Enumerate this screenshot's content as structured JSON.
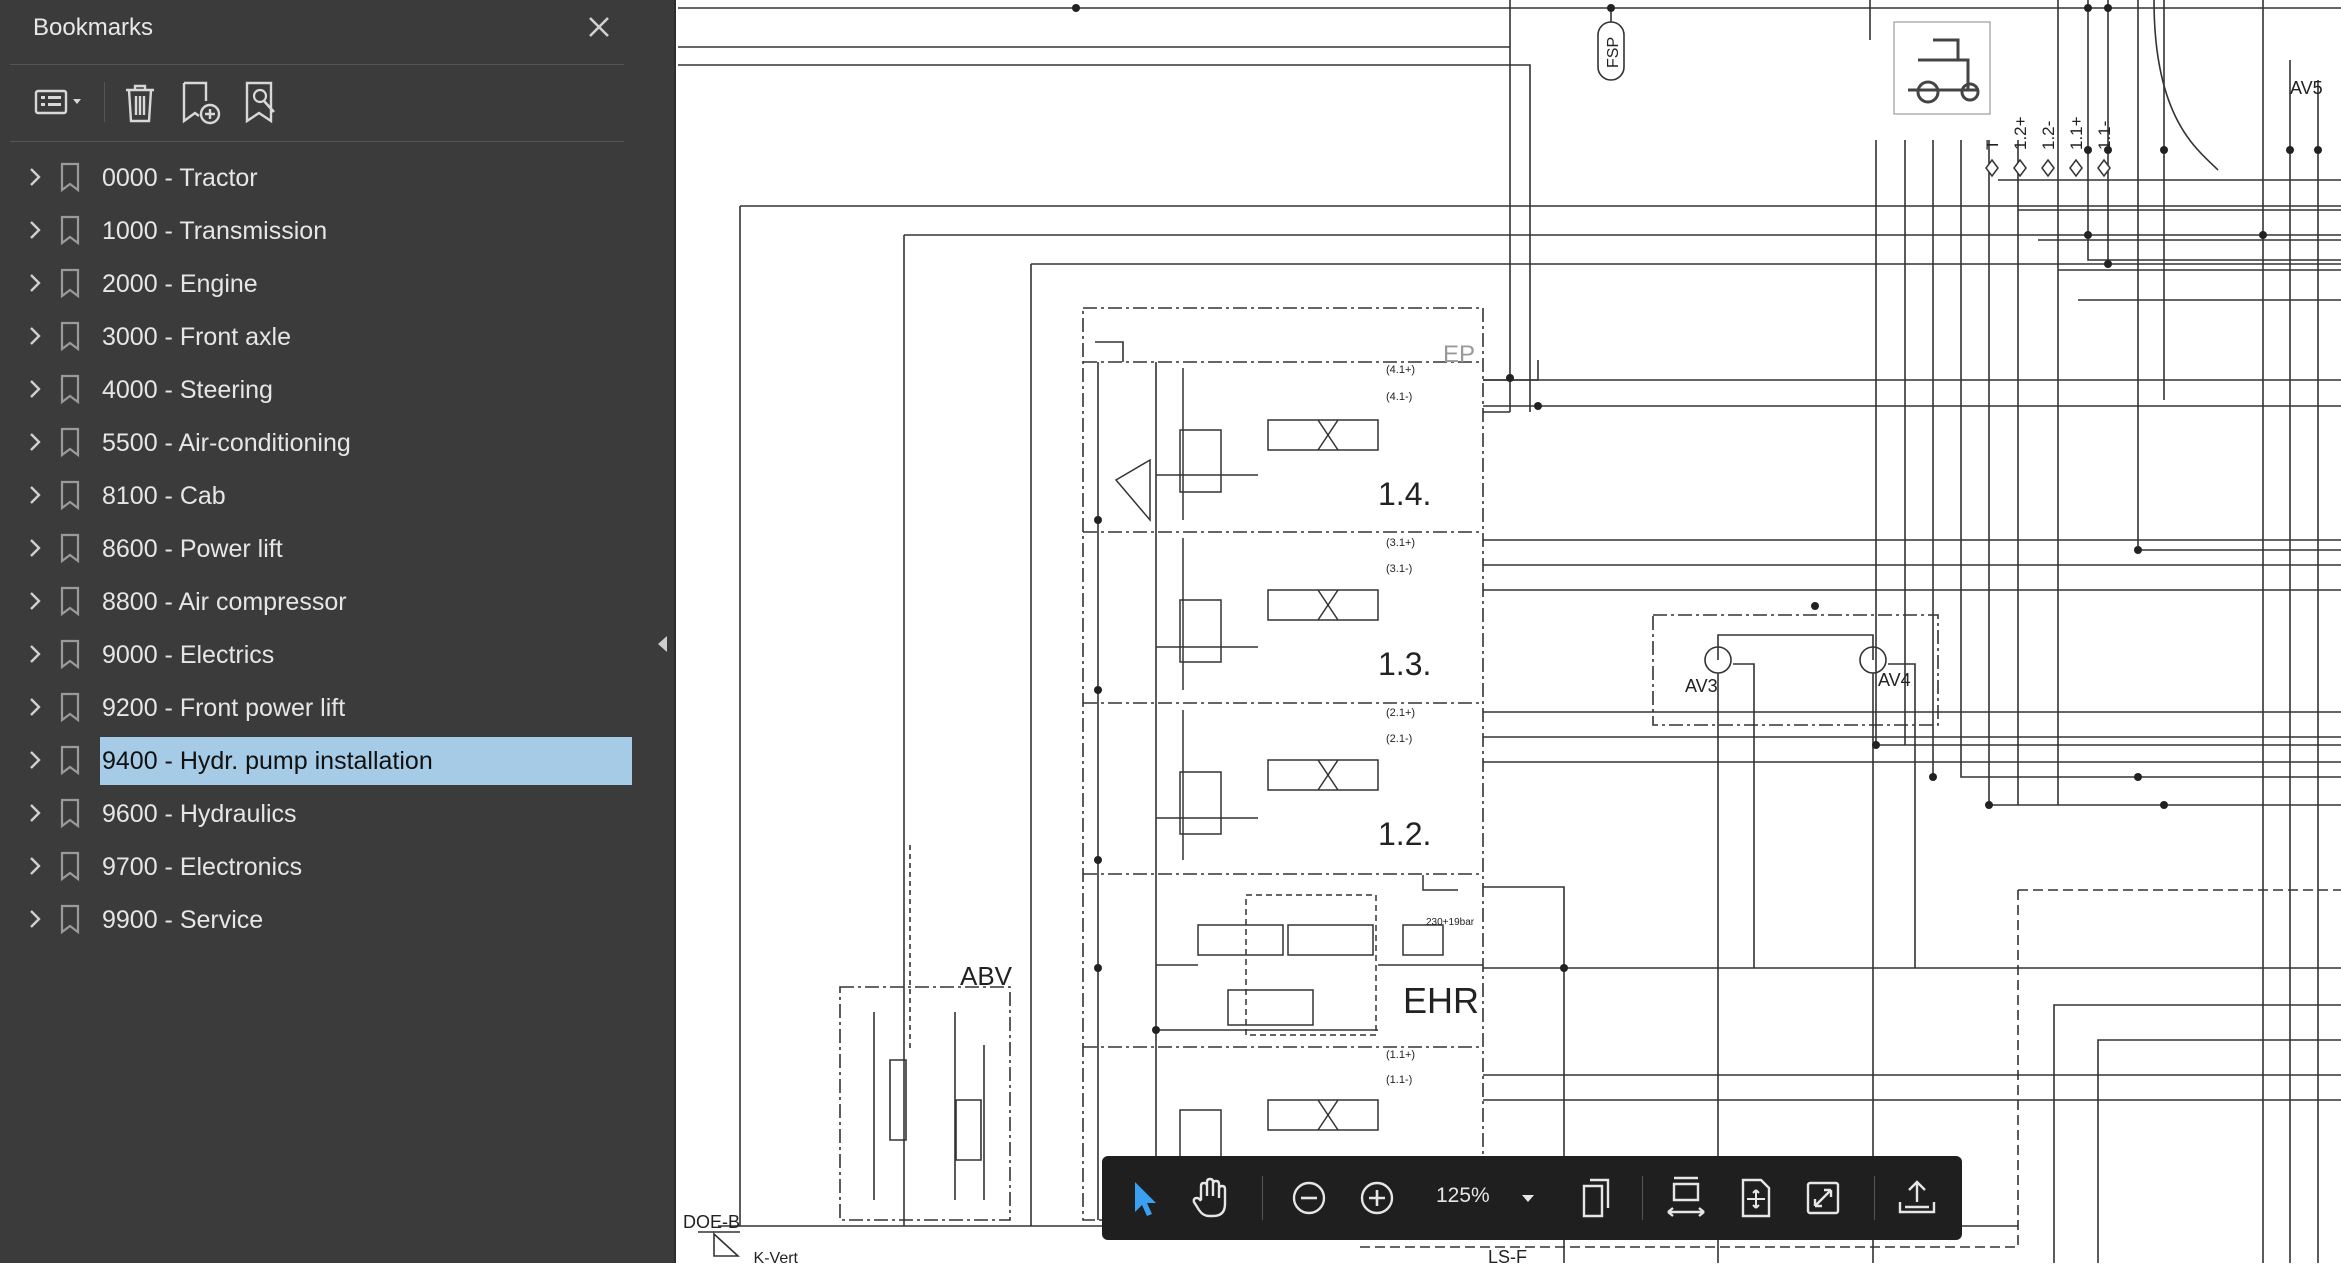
{
  "sidebar": {
    "title": "Bookmarks",
    "toolbar": {
      "options_icon": "list-options-icon",
      "delete_icon": "trash-icon",
      "add_icon": "add-bookmark-icon",
      "find_icon": "bookmark-search-icon"
    },
    "items": [
      {
        "label": "0000 - Tractor"
      },
      {
        "label": "1000 - Transmission"
      },
      {
        "label": "2000 - Engine"
      },
      {
        "label": "3000 - Front axle"
      },
      {
        "label": "4000 - Steering"
      },
      {
        "label": "5500 - Air-conditioning"
      },
      {
        "label": "8100 - Cab"
      },
      {
        "label": "8600 - Power lift"
      },
      {
        "label": "8800 - Air compressor"
      },
      {
        "label": "9000 - Electrics"
      },
      {
        "label": "9200 - Front power lift"
      },
      {
        "label": "9400 - Hydr. pump installation"
      },
      {
        "label": "9600 - Hydraulics"
      },
      {
        "label": "9700 - Electronics"
      },
      {
        "label": "9900 - Service"
      }
    ],
    "selected_index": 11
  },
  "drawing": {
    "labels": {
      "fsp": "FSP",
      "ep": "EP",
      "v14": "1.4.",
      "v13": "1.3.",
      "v12": "1.2.",
      "ehr": "EHR",
      "abv": "ABV",
      "av3": "AV3",
      "av4": "AV4",
      "av5": "AV5",
      "doe": "DOE-B",
      "kvert": "K-Vert",
      "lsf": "LS-F",
      "ports": [
        "T",
        "1.2+",
        "1.2-",
        "1.1+",
        "1.1-"
      ],
      "p41p": "(4.1+)",
      "p41m": "(4.1-)",
      "p31p": "(3.1+)",
      "p31m": "(3.1-)",
      "p21p": "(2.1+)",
      "p21m": "(2.1-)",
      "p11p": "(1.1+)",
      "p11m": "(1.1-)",
      "ehr_pressure": "230+19bar"
    }
  },
  "floating_toolbar": {
    "zoom": "125%",
    "colors": {
      "active": "#3aa0f0",
      "icon": "#e6e6e6",
      "bg": "#1f1f1f"
    }
  }
}
